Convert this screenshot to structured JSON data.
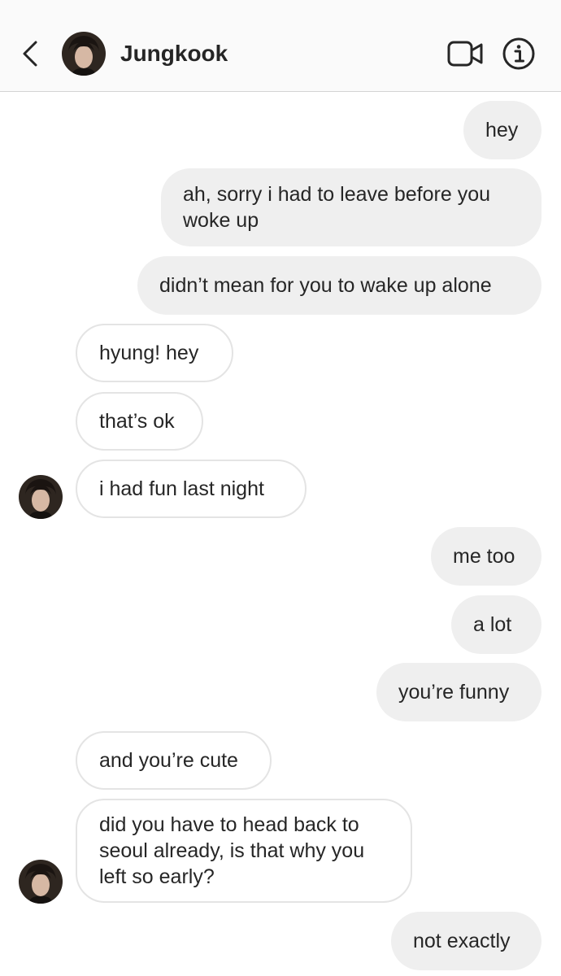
{
  "header": {
    "contact_name": "Jungkook",
    "back_icon": "chevron-left-icon",
    "video_icon": "video-camera-icon",
    "info_icon": "info-icon"
  },
  "messages": [
    {
      "sender": "me",
      "text": "hey"
    },
    {
      "sender": "me",
      "text": "ah, sorry i had to leave before you woke up"
    },
    {
      "sender": "me",
      "text": "didn’t mean for you to wake up alone"
    },
    {
      "sender": "them",
      "text": "hyung! hey"
    },
    {
      "sender": "them",
      "text": "that’s ok"
    },
    {
      "sender": "them",
      "text": "i had fun last night"
    },
    {
      "sender": "me",
      "text": "me too"
    },
    {
      "sender": "me",
      "text": "a lot"
    },
    {
      "sender": "me",
      "text": "you’re funny"
    },
    {
      "sender": "them",
      "text": "and you’re cute"
    },
    {
      "sender": "them",
      "text": "did you have to head back to seoul already, is that why you left so early?"
    },
    {
      "sender": "me",
      "text": "not exactly"
    }
  ],
  "colors": {
    "header_bg": "#fafafa",
    "my_bubble_bg": "#efefef",
    "their_bubble_border": "#e4e4e4",
    "text": "#262626"
  }
}
